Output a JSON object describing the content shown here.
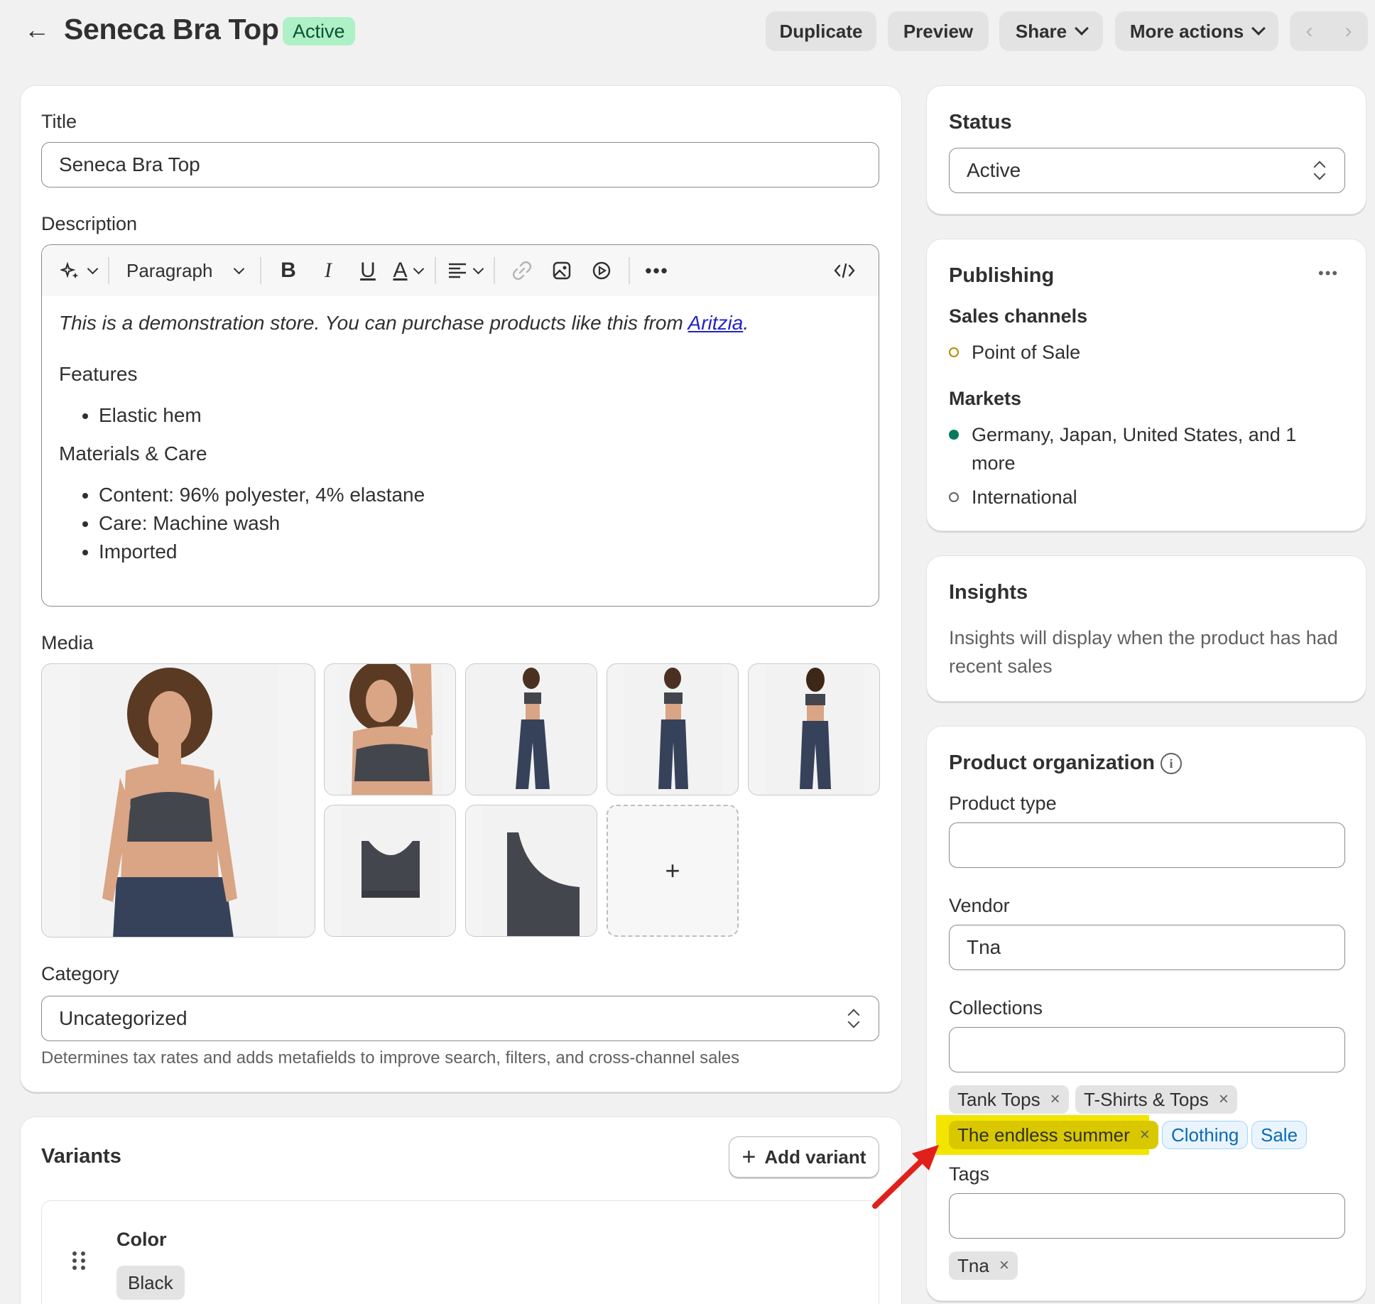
{
  "header": {
    "back_label": "←",
    "title": "Seneca Bra Top",
    "status_badge": "Active",
    "buttons": {
      "duplicate": "Duplicate",
      "preview": "Preview",
      "share": "Share",
      "more_actions": "More actions"
    },
    "pager": {
      "prev": "‹",
      "next": "›"
    }
  },
  "main": {
    "title_label": "Title",
    "title_value": "Seneca Bra Top",
    "description_label": "Description",
    "toolbar": {
      "paragraph": "Paragraph"
    },
    "description": {
      "intro": "This is a demonstration store. You can purchase products like this from ",
      "link": "Aritzia",
      "intro_end": ".",
      "features_heading": "Features",
      "features": [
        "Elastic hem"
      ],
      "materials_heading": "Materials & Care",
      "materials": [
        "Content: 96% polyester, 4% elastane",
        "Care: Machine wash",
        "Imported"
      ]
    },
    "media_label": "Media",
    "media_add": "+",
    "category_label": "Category",
    "category_value": "Uncategorized",
    "category_help": "Determines tax rates and adds metafields to improve search, filters, and cross-channel sales",
    "variants": {
      "heading": "Variants",
      "add_button": "Add variant",
      "add_icon": "+",
      "option_name": "Color",
      "option_values": [
        "Black"
      ]
    }
  },
  "sidebar": {
    "status": {
      "heading": "Status",
      "value": "Active"
    },
    "publishing": {
      "heading": "Publishing",
      "more": "•••",
      "sales_channels_label": "Sales channels",
      "sales_channels": [
        {
          "label": "Point of Sale",
          "state": "hollow",
          "color": "#b98900"
        }
      ],
      "markets_label": "Markets",
      "markets": [
        {
          "label": "Germany, Japan, United States, and 1 more",
          "state": "filled",
          "color": "#047b5d"
        },
        {
          "label": "International",
          "state": "hollow",
          "color": "#616161"
        }
      ]
    },
    "insights": {
      "heading": "Insights",
      "text": "Insights will display when the product has had recent sales"
    },
    "organization": {
      "heading": "Product organization",
      "info_icon": "i",
      "product_type_label": "Product type",
      "product_type_value": "",
      "vendor_label": "Vendor",
      "vendor_value": "Tna",
      "collections_label": "Collections",
      "collections_value": "",
      "collections": [
        "Tank Tops",
        "T-Shirts & Tops",
        "The endless summer"
      ],
      "suggested": [
        "Clothing",
        "Sale"
      ],
      "tags_label": "Tags",
      "tags_value": "",
      "tags": [
        "Tna"
      ],
      "remove_icon": "×"
    }
  },
  "colors": {
    "page_bg": "#f1f1f1",
    "badge_bg": "#aff1c6",
    "highlight": "#f3e500",
    "arrow": "#e0201b",
    "market_dot": "#047b5d"
  }
}
